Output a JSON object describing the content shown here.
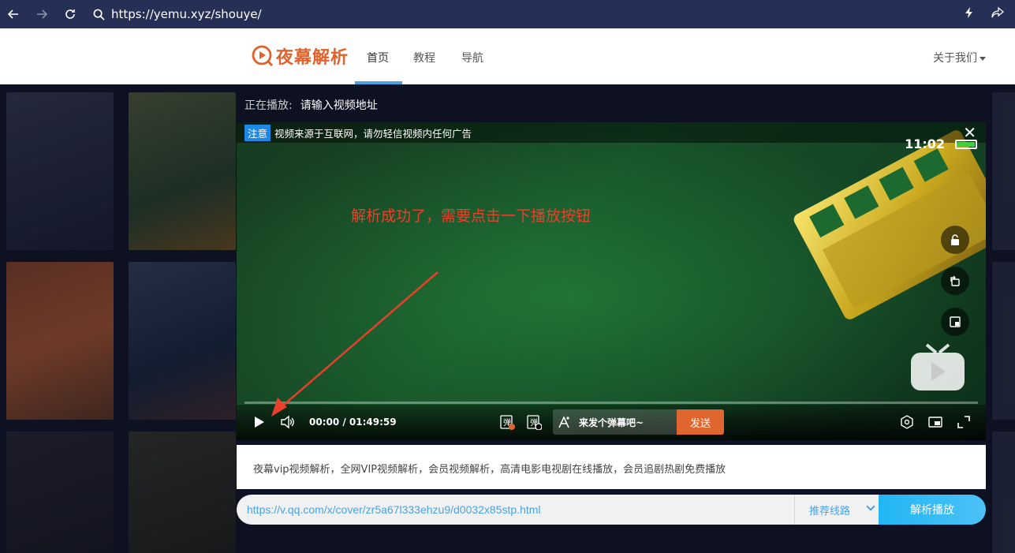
{
  "browser": {
    "url": "https://yemu.xyz/shouye/"
  },
  "site": {
    "logo_text": "夜幕解析",
    "nav": [
      {
        "label": "首页",
        "active": true
      },
      {
        "label": "教程",
        "active": false
      },
      {
        "label": "导航",
        "active": false
      }
    ],
    "about_label": "关于我们",
    "accent_color": "#e2612a"
  },
  "now_playing": {
    "label": "正在播放:",
    "value": "请输入视频地址"
  },
  "player": {
    "notice_tag": "注意",
    "notice_text": "视频来源于互联网，请勿轻信视频内任何广告",
    "clock": "11:02",
    "annotation": "解析成功了，需要点击一下播放按钮",
    "time_display": "00:00 / 01:49:59",
    "progress": 0,
    "danmu_placeholder": "来发个弹幕吧~",
    "send_label": "发送",
    "icons": [
      "play-icon",
      "volume-icon",
      "danmu-setting-icon",
      "danmu-toggle-icon",
      "font-icon",
      "settings-icon",
      "pip-icon",
      "fullscreen-icon",
      "lock-icon",
      "rotate-icon",
      "mini-window-icon",
      "close-icon",
      "battery-icon"
    ]
  },
  "description": "夜幕vip视频解析，全网VIP视频解析，会员视频解析，高清电影电视剧在线播放，会员追剧热剧免费播放",
  "parser": {
    "input_value": "https://v.qq.com/x/cover/zr5a67l333ehzu9/d0032x85stp.html",
    "route_selected": "推荐线路",
    "parse_label": "解析播放",
    "button_color": "#22b6f5"
  }
}
